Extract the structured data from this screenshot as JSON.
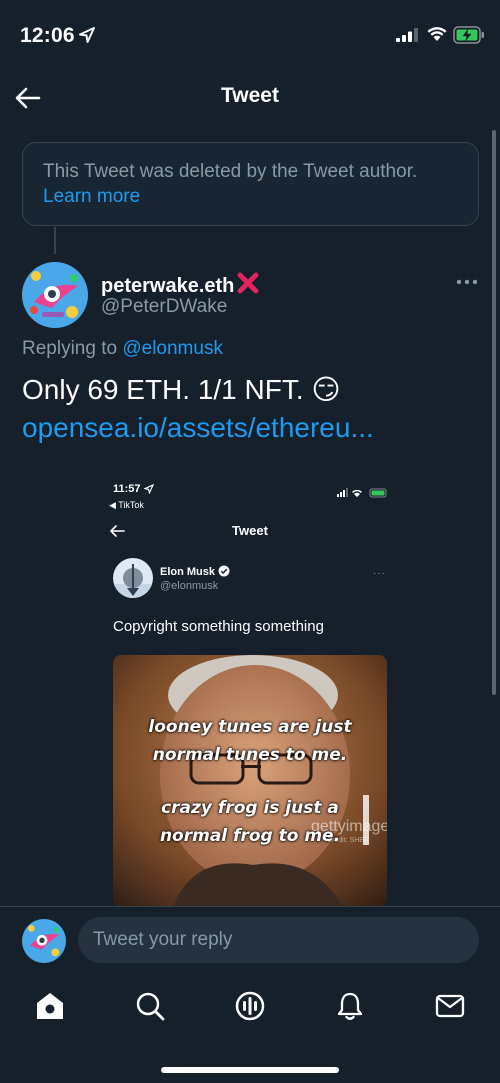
{
  "status_bar": {
    "time": "12:06"
  },
  "header": {
    "title": "Tweet"
  },
  "deleted_notice": {
    "text": "This Tweet was deleted by the Tweet author.",
    "link": "Learn more"
  },
  "tweet": {
    "display_name": "peterwake.eth",
    "handle": "@PeterDWake",
    "replying_prefix": "Replying to",
    "replying_to": "@elonmusk",
    "text": "Only 69 ETH. 1/1 NFT. 😏",
    "link": "opensea.io/assets/ethereu..."
  },
  "embedded": {
    "time": "11:57",
    "back_app": "◀ TikTok",
    "title": "Tweet",
    "name": "Elon Musk",
    "handle": "@elonmusk",
    "more": "···",
    "text": "Copyright something something",
    "meme_lines": [
      "looney tunes are just",
      "normal tunes to me.",
      "crazy frog is just a",
      "normal frog to me."
    ],
    "watermark": "gettyimages",
    "watermark_sub": "Credit: SHER"
  },
  "reply": {
    "placeholder": "Tweet your reply"
  },
  "tabs": [
    "home-icon",
    "search-icon",
    "spaces-icon",
    "notifications-icon",
    "messages-icon"
  ],
  "colors": {
    "background": "#15202b",
    "accent": "#1d9bf0",
    "muted": "#8899a6",
    "border": "#38444d"
  }
}
